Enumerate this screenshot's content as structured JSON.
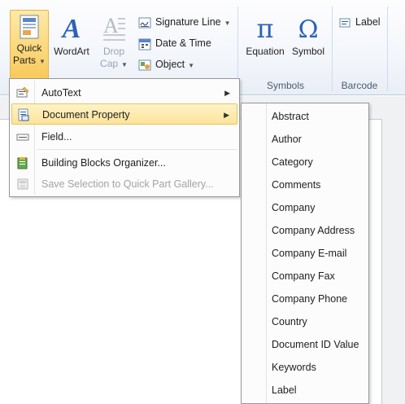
{
  "ribbon": {
    "quick_parts": "Quick\nParts",
    "quick_parts_l1": "Quick",
    "quick_parts_l2": "Parts",
    "wordart_l1": "WordArt",
    "dropcap_l1": "Drop",
    "dropcap_l2": "Cap",
    "signature_line": "Signature Line",
    "date_time": "Date & Time",
    "object": "Object",
    "equation": "Equation",
    "symbol": "Symbol",
    "label": "Label",
    "group_symbols": "Symbols",
    "group_barcode": "Barcode"
  },
  "quick_parts_menu": {
    "autotext": "AutoText",
    "document_property": "Document Property",
    "field": "Field...",
    "building_blocks": "Building Blocks Organizer...",
    "save_selection": "Save Selection to Quick Part Gallery..."
  },
  "document_property_submenu": [
    "Abstract",
    "Author",
    "Category",
    "Comments",
    "Company",
    "Company Address",
    "Company E-mail",
    "Company Fax",
    "Company Phone",
    "Country",
    "Document ID Value",
    "Keywords",
    "Label"
  ],
  "icons": {
    "quick_parts": "quick-parts-icon",
    "wordart": "wordart-icon",
    "drop_cap": "drop-cap-icon",
    "signature_line": "signature-line-icon",
    "date_time": "date-time-icon",
    "object": "object-icon",
    "equation": "pi-icon",
    "symbol": "omega-icon",
    "label": "label-icon"
  },
  "colors": {
    "highlight": "#fde39a",
    "accent_blue": "#2a5aa8",
    "disabled": "#a3a3a3"
  }
}
